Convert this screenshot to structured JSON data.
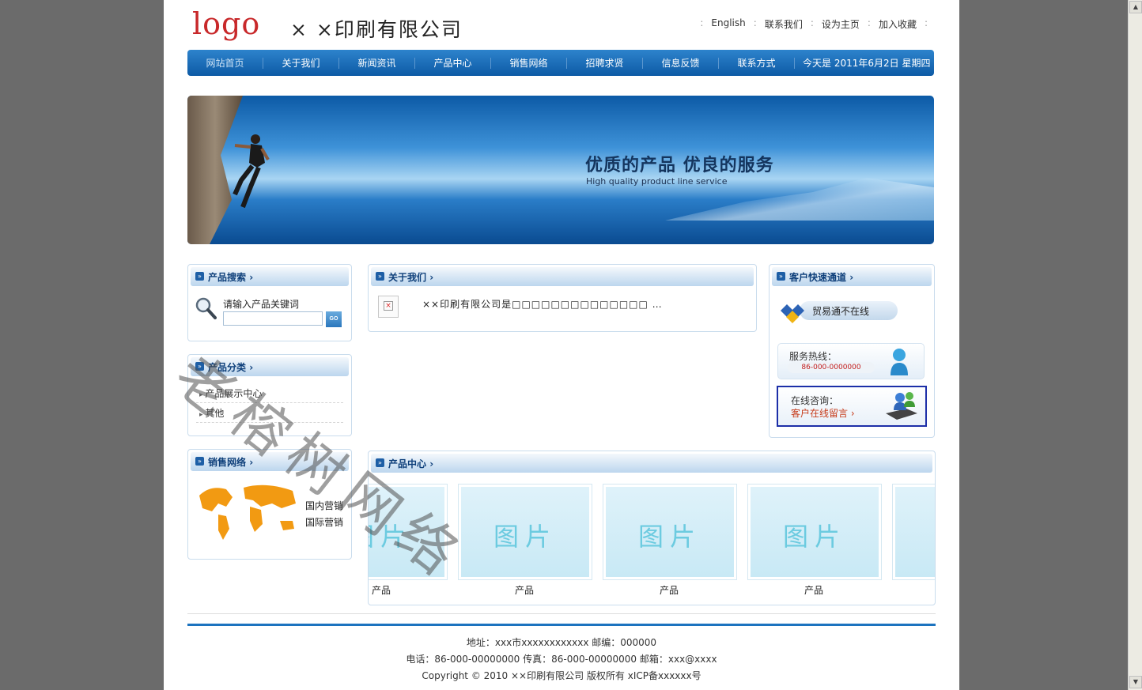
{
  "header": {
    "logo": "logo",
    "company": "× ×印刷有限公司",
    "links": [
      "English",
      "联系我们",
      "设为主页",
      "加入收藏"
    ]
  },
  "nav": {
    "items": [
      "网站首页",
      "关于我们",
      "新闻资讯",
      "产品中心",
      "销售网络",
      "招聘求贤",
      "信息反馈",
      "联系方式"
    ],
    "date": "今天是 2011年6月2日 星期四"
  },
  "banner": {
    "slogan": "优质的产品 优良的服务",
    "sub": "High quality product line service"
  },
  "search": {
    "title": "产品搜索",
    "label": "请输入产品关键词",
    "value": "",
    "go": "GO"
  },
  "categories": {
    "title": "产品分类",
    "items": [
      "产品展示中心",
      "其他"
    ]
  },
  "network": {
    "title": "销售网络",
    "items": [
      "国内营销",
      "国际营销"
    ]
  },
  "about": {
    "title": "关于我们",
    "text": "××印刷有限公司是□□□□□□□□□□□□□□ …"
  },
  "service": {
    "title": "客户快速通道",
    "maoyi": "贸易通不在线",
    "hotline_label": "服务热线：",
    "hotline": "86-000-0000000",
    "consult_label": "在线咨询：",
    "consult_link": "客户在线留言"
  },
  "products": {
    "title": "产品中心",
    "pic_text": "图片",
    "items": [
      "产品",
      "产品",
      "产品",
      "产品"
    ],
    "first_partial": "产品"
  },
  "watermark": "老榕树网络",
  "footer": {
    "address": "地址：xxx市xxxxxxxxxxxx 邮编：000000",
    "contact": "电话：86-000-00000000 传真：86-000-00000000 邮箱：xxx@xxxx",
    "copyright": "Copyright © 2010 ××印刷有限公司 版权所有 xICP备xxxxxx号"
  },
  "colors": {
    "nav": "#0d5aa5",
    "logo": "#c8282a",
    "title": "#0e3f7a",
    "footer_line": "#1c73bf"
  }
}
